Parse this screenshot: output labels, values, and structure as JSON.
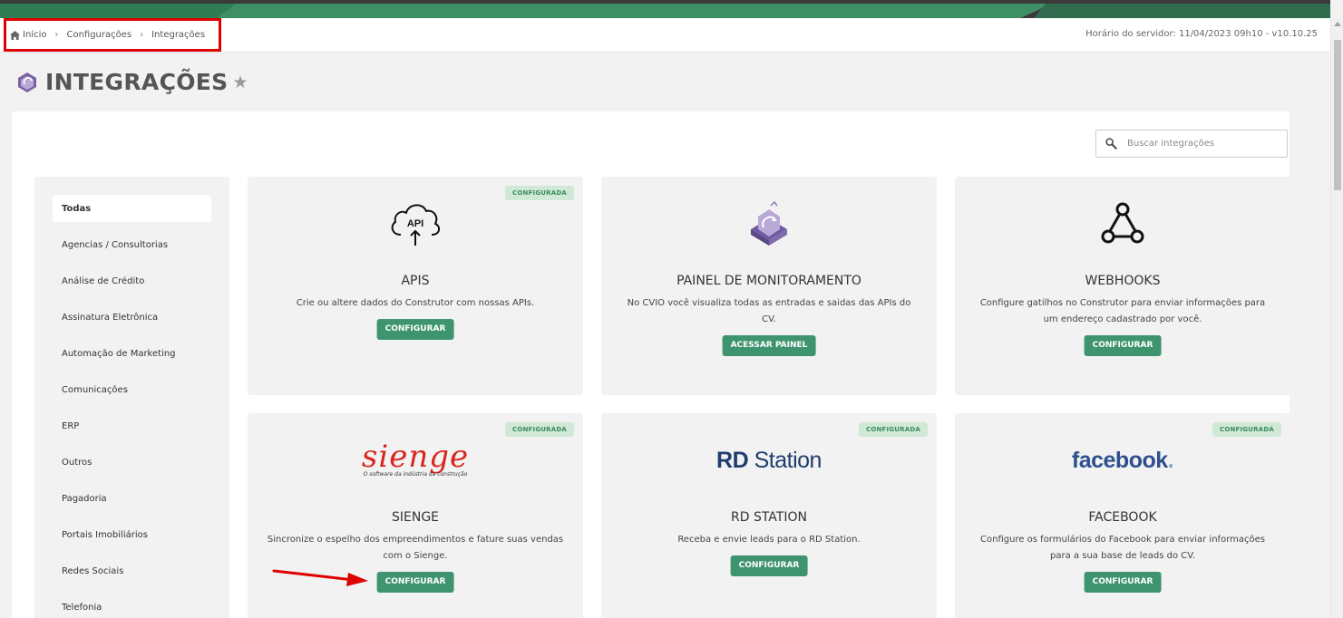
{
  "breadcrumb": {
    "items": [
      "Início",
      "Configurações",
      "Integrações"
    ]
  },
  "server_info": "Horário do servidor: 11/04/2023 09h10 - v10.10.25",
  "page": {
    "title": "INTEGRAÇÕES"
  },
  "search": {
    "placeholder": "Buscar integrações"
  },
  "sidebar": {
    "items": [
      {
        "label": "Todas",
        "active": true
      },
      {
        "label": "Agencias / Consultorias"
      },
      {
        "label": "Análise de Crédito"
      },
      {
        "label": "Assinatura Eletrônica"
      },
      {
        "label": "Automação de Marketing"
      },
      {
        "label": "Comunicações"
      },
      {
        "label": "ERP"
      },
      {
        "label": "Outros"
      },
      {
        "label": "Pagadoria"
      },
      {
        "label": "Portais Imobiliários"
      },
      {
        "label": "Redes Sociais"
      },
      {
        "label": "Telefonia"
      }
    ]
  },
  "cards": [
    {
      "name": "APIS",
      "badge": "CONFIGURADA",
      "description": "Crie ou altere dados do Construtor com nossas APIs.",
      "button": "CONFIGURAR",
      "icon": "cloud-api-icon"
    },
    {
      "name": "PAINEL DE MONITORAMENTO",
      "badge": "",
      "description": "No CVIO você visualiza todas as entradas e saidas das APIs do CV.",
      "button": "ACESSAR PAINEL",
      "icon": "cvio-logo-icon"
    },
    {
      "name": "WEBHOOKS",
      "badge": "",
      "description": "Configure gatilhos no Construtor para enviar informações para um endereço cadastrado por você.",
      "button": "CONFIGURAR",
      "icon": "webhook-icon"
    },
    {
      "name": "SIENGE",
      "badge": "CONFIGURADA",
      "description": "Sincronize o espelho dos empreendimentos e fature suas vendas com o Sienge.",
      "button": "CONFIGURAR",
      "logo_text": "sienge",
      "logo_sub": "O software da indústria da construção"
    },
    {
      "name": "RD STATION",
      "badge": "CONFIGURADA",
      "description": "Receba e envie leads para o RD Station.",
      "button": "CONFIGURAR",
      "logo_bold": "RD",
      "logo_rest": " Station"
    },
    {
      "name": "FACEBOOK",
      "badge": "CONFIGURADA",
      "description": "Configure os formulários do Facebook para enviar informações para a sua base de leads do CV.",
      "button": "CONFIGURAR",
      "logo_text": "facebook",
      "logo_dot": "."
    }
  ],
  "colors": {
    "accent_green": "#3f9470",
    "badge_bg": "#cfe9d6",
    "badge_text": "#3c8b5d",
    "highlight_red": "#e00000"
  }
}
